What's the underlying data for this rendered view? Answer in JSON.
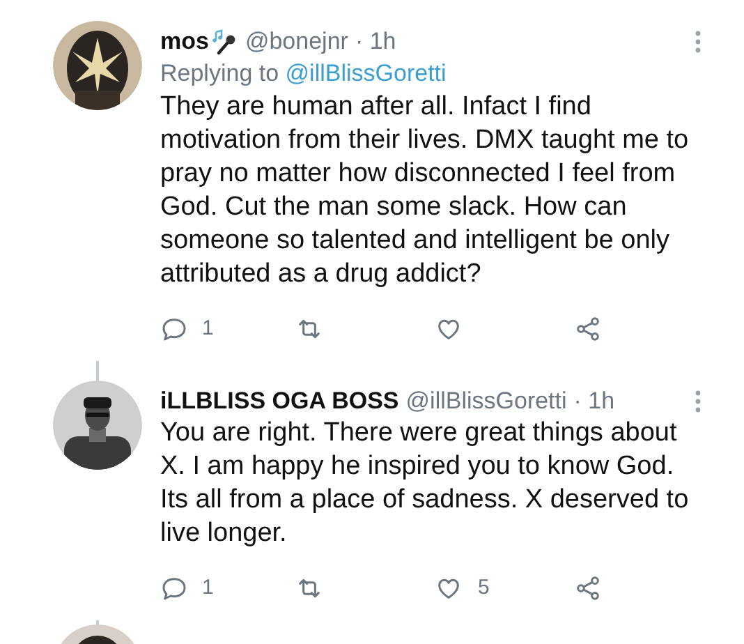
{
  "tweets": [
    {
      "name": "mos",
      "handle": "@bonejnr",
      "time": "· 1h",
      "replying_to_label": "Replying to",
      "replying_to": "@illBlissGoretti",
      "text": "They are human after all. Infact I find motivation from their lives. DMX taught me to pray no matter how disconnected I feel from God. Cut the man some slack. How can someone so talented and intelligent be only attributed as a drug addict?",
      "name_icon": true,
      "actions": {
        "replies": "1"
      }
    },
    {
      "name": "iLLBLISS OGA BOSS",
      "handle": "@illBlissGoretti",
      "time": "· 1h",
      "text": "You are right. There were great things about X. I am happy he inspired you to know God. Its all from a place of sadness. X deserved to live longer.",
      "name_icon": false,
      "actions": {
        "replies": "1",
        "likes": "5"
      }
    }
  ]
}
